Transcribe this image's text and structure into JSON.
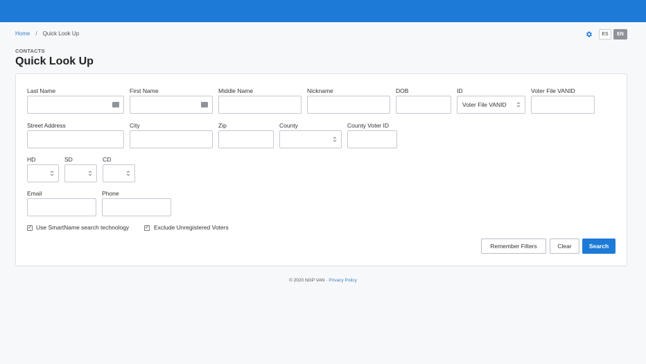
{
  "breadcrumb": {
    "home": "Home",
    "separator": "/",
    "current": "Quick Look Up"
  },
  "header": {
    "lang_es": "ES",
    "lang_en": "EN",
    "active_language": "EN",
    "accent_color": "#1d7bd7"
  },
  "page": {
    "section": "CONTACTS",
    "title": "Quick Look Up"
  },
  "form": {
    "last_name": {
      "label": "Last Name",
      "value": ""
    },
    "first_name": {
      "label": "First Name",
      "value": ""
    },
    "middle_name": {
      "label": "Middle Name",
      "value": ""
    },
    "nickname": {
      "label": "Nickname",
      "value": ""
    },
    "dob": {
      "label": "DOB",
      "value": ""
    },
    "id_type": {
      "label": "ID",
      "selected": "Voter File VANID"
    },
    "voter_file_vanid": {
      "label": "Voter File VANID",
      "value": ""
    },
    "street_address": {
      "label": "Street Address",
      "value": ""
    },
    "city": {
      "label": "City",
      "value": ""
    },
    "zip": {
      "label": "Zip",
      "value": ""
    },
    "county": {
      "label": "County",
      "selected": ""
    },
    "county_voter_id": {
      "label": "County Voter ID",
      "value": ""
    },
    "hd": {
      "label": "HD",
      "selected": ""
    },
    "sd": {
      "label": "SD",
      "selected": ""
    },
    "cd": {
      "label": "CD",
      "selected": ""
    },
    "email": {
      "label": "Email",
      "value": ""
    },
    "phone": {
      "label": "Phone",
      "value": ""
    },
    "smartname": {
      "label": "Use SmartName search technology",
      "checked": true,
      "mark": "✓"
    },
    "exclude_unregistered": {
      "label": "Exclude Unregistered Voters",
      "checked": true,
      "mark": "✓"
    }
  },
  "buttons": {
    "remember": "Remember Filters",
    "clear": "Clear",
    "search": "Search"
  },
  "footer": {
    "copyright": "© 2020 NGP VAN",
    "divider": "·",
    "privacy": "Privacy Policy"
  }
}
